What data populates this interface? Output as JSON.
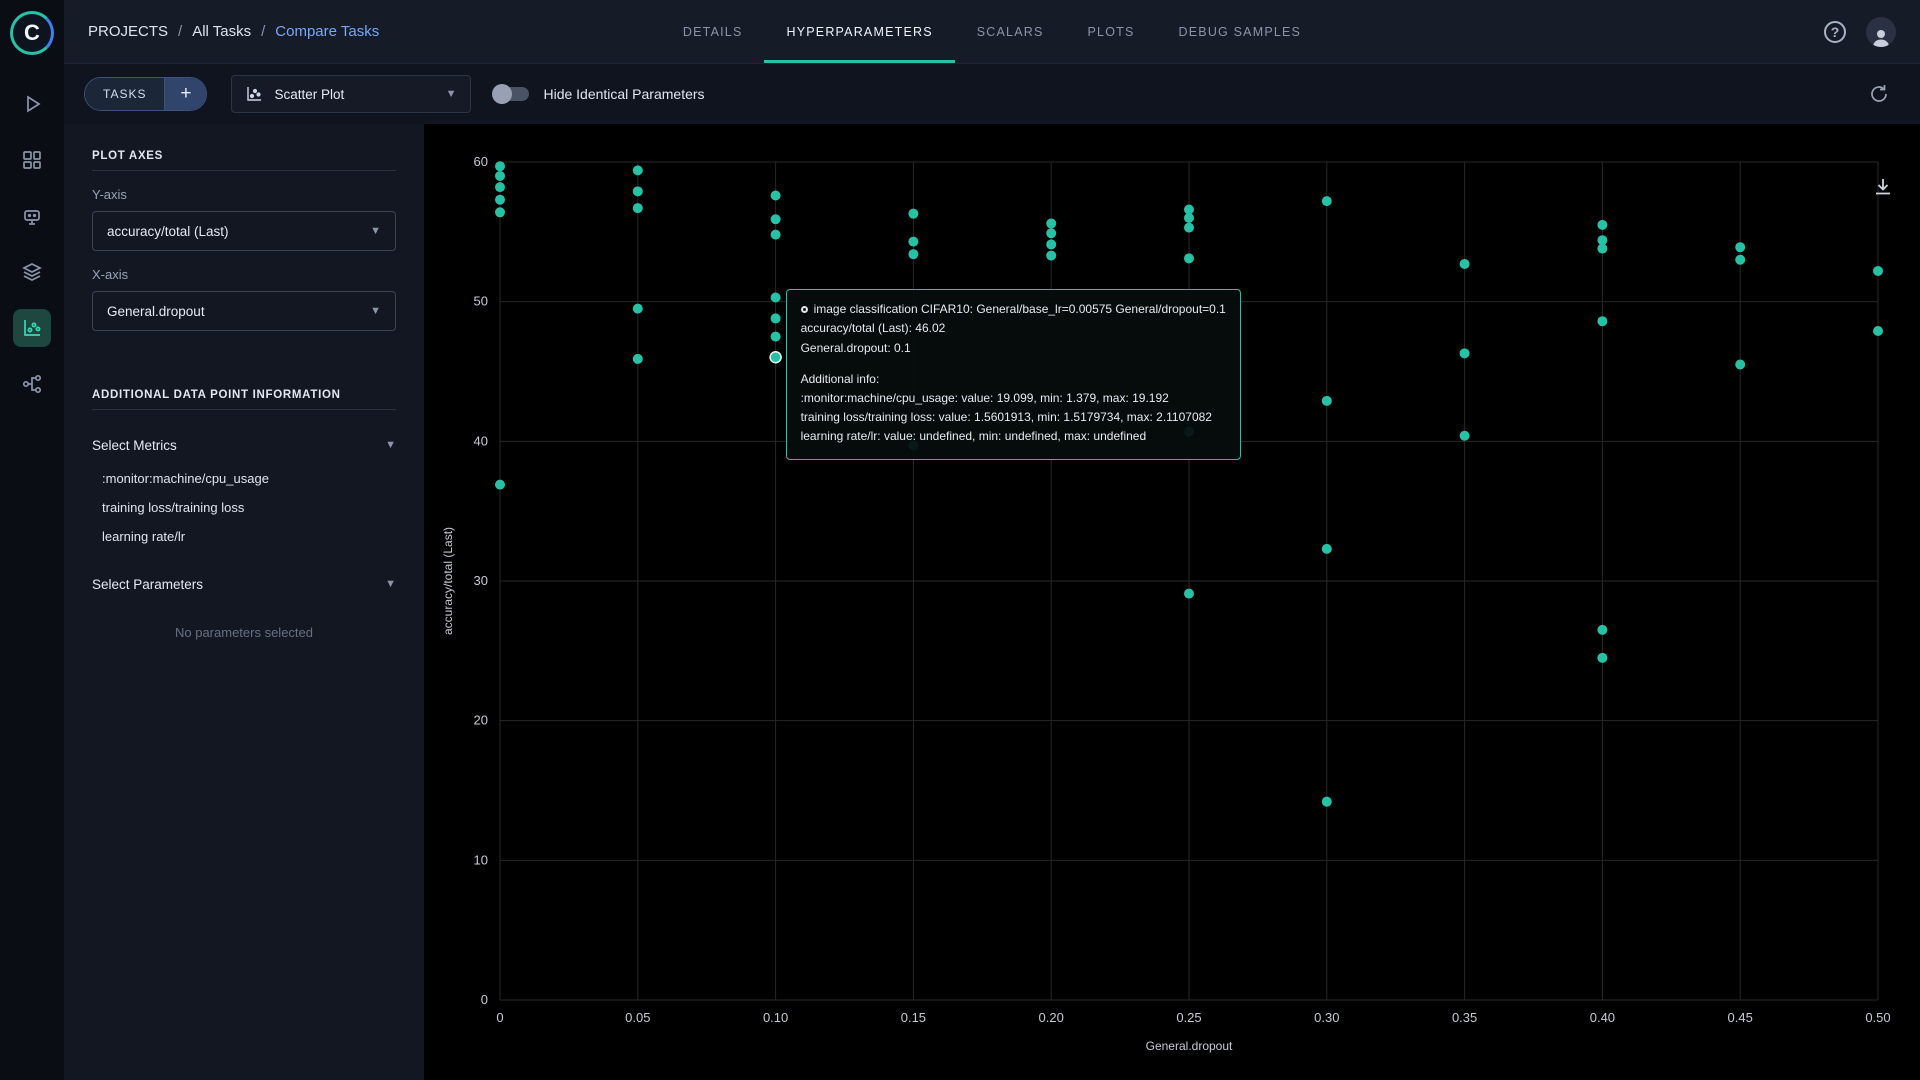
{
  "app": {
    "name": "ClearML",
    "logo_letter": "C",
    "colors": {
      "accent_teal": "#27c2a5",
      "breadcrumb_active": "#76a8f9",
      "topbar_bg": "#161b28",
      "sidebar_bg": "#131722",
      "plot_bg": "#000000"
    }
  },
  "rail": {
    "icons": [
      "getting-started-icon",
      "dashboard-icon",
      "workers-icon",
      "datasets-icon",
      "experiments-compare-icon",
      "pipelines-icon"
    ],
    "active_icon": "experiments-compare-icon"
  },
  "header": {
    "breadcrumb": [
      {
        "label": "PROJECTS"
      },
      {
        "label": "All Tasks"
      },
      {
        "label": "Compare Tasks"
      }
    ],
    "tabs": [
      {
        "label": "DETAILS",
        "active": false
      },
      {
        "label": "HYPERPARAMETERS",
        "active": true
      },
      {
        "label": "SCALARS",
        "active": false
      },
      {
        "label": "PLOTS",
        "active": false
      },
      {
        "label": "DEBUG SAMPLES",
        "active": false
      }
    ],
    "help_icon": "?",
    "icons": [
      "help-icon",
      "user-avatar"
    ]
  },
  "toolbar": {
    "tasks_button_label": "TASKS",
    "add_button_label": "+",
    "plot_type_value": "Scatter Plot",
    "toggle_label": "Hide Identical Parameters",
    "toggle_state": "off",
    "icons": [
      "scatter-plot-icon",
      "auto-refresh-icon"
    ]
  },
  "sidebar": {
    "plot_axes_title": "PLOT AXES",
    "y_axis_label": "Y-axis",
    "y_axis_value": "accuracy/total (Last)",
    "x_axis_label": "X-axis",
    "x_axis_value": "General.dropout",
    "additional_title": "ADDITIONAL DATA POINT INFORMATION",
    "select_metrics_label": "Select Metrics",
    "metrics_list": [
      ":monitor:machine/cpu_usage",
      "training loss/training loss",
      "learning rate/lr"
    ],
    "select_parameters_label": "Select Parameters",
    "no_parameters_text": "No parameters selected"
  },
  "chart_data": {
    "type": "scatter",
    "title": "",
    "xlabel": "General.dropout",
    "ylabel": "accuracy/total (Last)",
    "xlim": [
      0,
      0.5
    ],
    "ylim": [
      0,
      60
    ],
    "grid": true,
    "grid_color": "#272727",
    "tick_color": "#c6cbd4",
    "point_color": "#27c2a5",
    "xticks": [
      {
        "v": 0,
        "label": "0"
      },
      {
        "v": 0.05,
        "label": "0.05"
      },
      {
        "v": 0.1,
        "label": "0.10"
      },
      {
        "v": 0.15,
        "label": "0.15"
      },
      {
        "v": 0.2,
        "label": "0.20"
      },
      {
        "v": 0.25,
        "label": "0.25"
      },
      {
        "v": 0.3,
        "label": "0.30"
      },
      {
        "v": 0.35,
        "label": "0.35"
      },
      {
        "v": 0.4,
        "label": "0.40"
      },
      {
        "v": 0.45,
        "label": "0.45"
      },
      {
        "v": 0.5,
        "label": "0.50"
      }
    ],
    "yticks": [
      {
        "v": 0,
        "label": "0"
      },
      {
        "v": 10,
        "label": "10"
      },
      {
        "v": 20,
        "label": "20"
      },
      {
        "v": 30,
        "label": "30"
      },
      {
        "v": 40,
        "label": "40"
      },
      {
        "v": 50,
        "label": "50"
      },
      {
        "v": 60,
        "label": "60"
      }
    ],
    "points": [
      [
        0,
        59.7
      ],
      [
        0,
        59.0
      ],
      [
        0,
        58.2
      ],
      [
        0,
        57.3
      ],
      [
        0,
        56.4
      ],
      [
        0,
        36.9
      ],
      [
        0.05,
        59.4
      ],
      [
        0.05,
        57.9
      ],
      [
        0.05,
        56.7
      ],
      [
        0.05,
        49.5
      ],
      [
        0.05,
        45.9
      ],
      [
        0.1,
        57.6
      ],
      [
        0.1,
        55.9
      ],
      [
        0.1,
        54.8
      ],
      [
        0.1,
        50.3
      ],
      [
        0.1,
        48.8
      ],
      [
        0.1,
        47.5
      ],
      [
        0.15,
        56.3
      ],
      [
        0.15,
        54.3
      ],
      [
        0.15,
        53.4
      ],
      [
        0.15,
        39.7
      ],
      [
        0.2,
        55.6
      ],
      [
        0.2,
        54.9
      ],
      [
        0.2,
        54.1
      ],
      [
        0.2,
        53.3
      ],
      [
        0.25,
        56.6
      ],
      [
        0.25,
        56.0
      ],
      [
        0.25,
        55.3
      ],
      [
        0.25,
        53.1
      ],
      [
        0.25,
        40.7
      ],
      [
        0.25,
        29.1
      ],
      [
        0.3,
        57.2
      ],
      [
        0.3,
        42.9
      ],
      [
        0.3,
        32.3
      ],
      [
        0.3,
        14.2
      ],
      [
        0.35,
        52.7
      ],
      [
        0.35,
        46.3
      ],
      [
        0.35,
        40.4
      ],
      [
        0.4,
        55.5
      ],
      [
        0.4,
        54.4
      ],
      [
        0.4,
        53.8
      ],
      [
        0.4,
        48.6
      ],
      [
        0.4,
        26.5
      ],
      [
        0.4,
        24.5
      ],
      [
        0.45,
        53.9
      ],
      [
        0.45,
        53.0
      ],
      [
        0.45,
        45.5
      ],
      [
        0.5,
        52.2
      ],
      [
        0.5,
        47.9
      ]
    ],
    "highlight_point": {
      "x": 0.1,
      "y": 46.02
    }
  },
  "tooltip": {
    "title": "image classification CIFAR10: General/base_lr=0.00575 General/dropout=0.1",
    "metric_line": "accuracy/total (Last): 46.02",
    "param_line": "General.dropout: 0.1",
    "info_header": "Additional info:",
    "info": [
      ":monitor:machine/cpu_usage: value: 19.099, min: 1.379, max: 19.192",
      "training loss/training loss: value: 1.5601913, min: 1.5179734, max: 2.1107082",
      "learning rate/lr: value: undefined, min: undefined, max: undefined"
    ]
  }
}
